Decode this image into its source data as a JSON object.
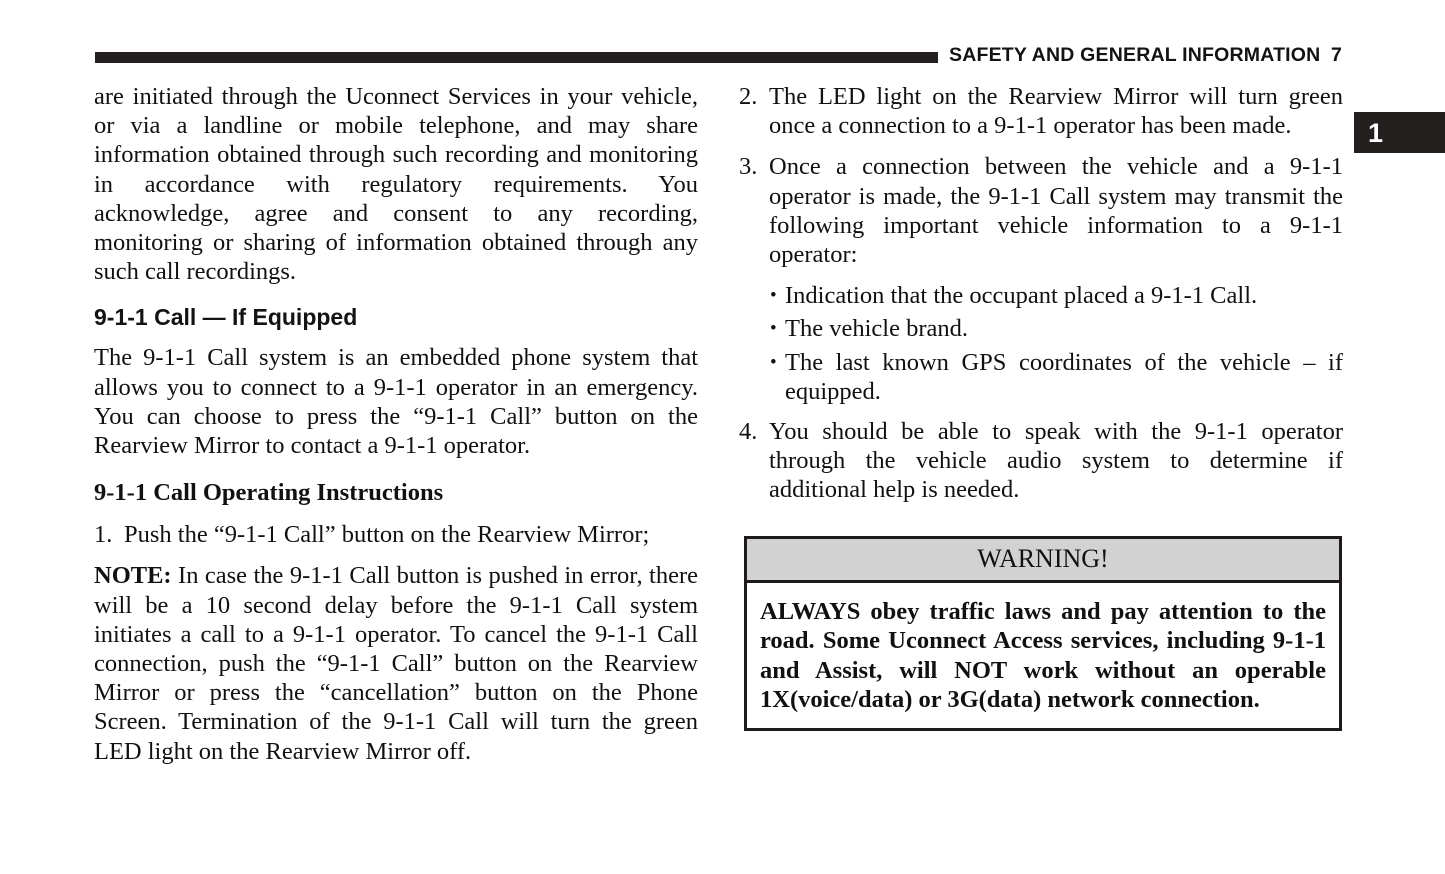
{
  "header": {
    "title": "SAFETY AND GENERAL INFORMATION",
    "page_number": "7",
    "bar_color": "#231f1e"
  },
  "chapter_tab": {
    "label": "1",
    "background": "#231f1e",
    "text_color": "#ffffff"
  },
  "left_column": {
    "paragraph_continued": "are initiated through the Uconnect Services in your vehicle, or via a landline or mobile telephone, and may share information obtained through such recording and monitoring in accordance with regulatory requirements. You acknowledge, agree and consent to any recording, monitoring or sharing of information obtained through any such call recordings.",
    "heading_equipped": "9-1-1 Call — If Equipped",
    "paragraph_system": "The 9-1-1 Call system is an embedded phone system that allows you to connect to a 9-1-1 operator in an emergency. You can choose to press the “9-1-1 Call” button on the Rearview Mirror to contact a 9-1-1 operator.",
    "heading_instructions": "9-1-1 Call Operating Instructions",
    "step_1_marker": "1.",
    "step_1_text": "Push the “9-1-1 Call” button on the Rearview Mirror;",
    "note_label": "NOTE:",
    "note_text": " In case the 9-1-1 Call button is pushed in error, there will be a 10 second delay before the 9-1-1 Call system initiates a call to a 9-1-1 operator. To cancel the 9-1-1 Call connection, push the “9-1-1 Call” button on the Rearview Mirror or press the “cancellation” button on the Phone Screen. Termination of the 9-1-1 Call will turn the green LED light on the Rearview Mirror off."
  },
  "right_column": {
    "step_2_marker": "2.",
    "step_2_text": "The LED light on the Rearview Mirror will turn green once a connection to a 9-1-1 operator has been made.",
    "step_3_marker": "3.",
    "step_3_text": "Once a connection between the vehicle and a 9-1-1 operator is made, the 9-1-1 Call system may transmit the following important vehicle information to a 9-1-1 operator:",
    "bullets": [
      "Indication that the occupant placed a 9-1-1 Call.",
      "The vehicle brand.",
      "The last known GPS coordinates of the vehicle – if equipped."
    ],
    "bullet_glyph": "•",
    "step_4_marker": "4.",
    "step_4_text": "You should be able to speak with the 9-1-1 operator through the vehicle audio system to determine if additional help is needed."
  },
  "warning": {
    "title": "WARNING!",
    "body": "ALWAYS obey traffic laws and pay attention to the road. Some Uconnect Access services, including 9-1-1 and Assist, will NOT work without an operable 1X(voice/data) or 3G(data) network connection.",
    "header_background": "#d2d2d2",
    "border_color": "#1d1a19"
  }
}
